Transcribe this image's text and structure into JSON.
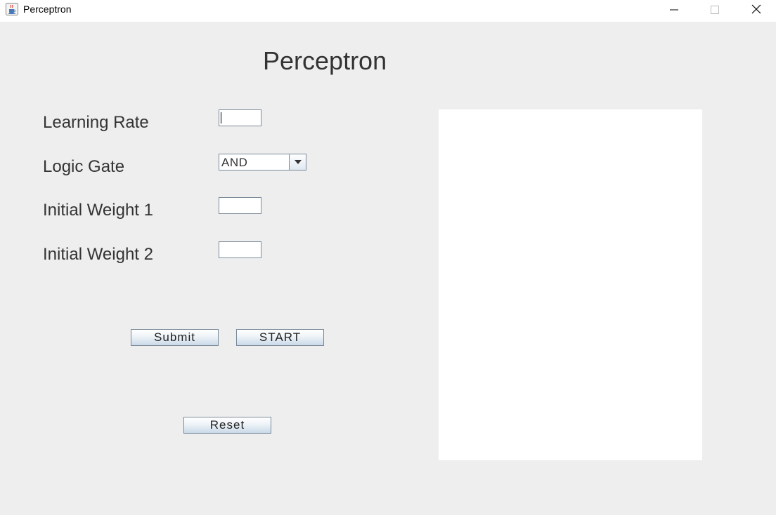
{
  "window": {
    "title": "Perceptron",
    "icon": "java-cup-icon",
    "controls": [
      "minimize-icon",
      "maximize-icon",
      "close-icon"
    ]
  },
  "form": {
    "heading": "Perceptron",
    "learning_rate": {
      "label": "Learning Rate",
      "value": ""
    },
    "logic_gate": {
      "label": "Logic Gate",
      "selected": "AND"
    },
    "weight1": {
      "label": "Initial Weight 1",
      "value": ""
    },
    "weight2": {
      "label": "Initial Weight 2",
      "value": ""
    }
  },
  "buttons": {
    "submit": "Submit",
    "start": "START",
    "reset": "Reset"
  },
  "colors": {
    "background": "#eeeeee",
    "button_gradient_bottom": "#c9d9e8",
    "border": "#7a8a99"
  }
}
